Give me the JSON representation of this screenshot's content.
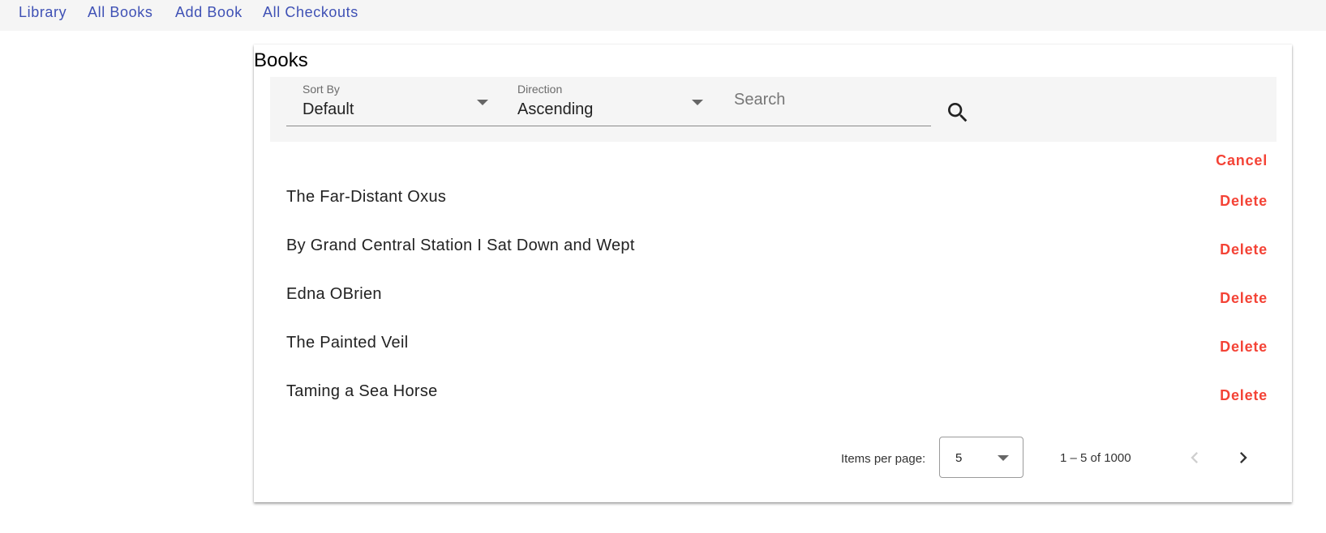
{
  "nav": {
    "items": [
      {
        "label": "Library"
      },
      {
        "label": "All Books"
      },
      {
        "label": "Add Book"
      },
      {
        "label": "All Checkouts"
      }
    ]
  },
  "card": {
    "title": "Books"
  },
  "filters": {
    "sort_by": {
      "label": "Sort By",
      "value": "Default"
    },
    "direction": {
      "label": "Direction",
      "value": "Ascending"
    },
    "search": {
      "placeholder": "Search",
      "value": ""
    },
    "search_icon": "search-icon"
  },
  "cancel_label": "Cancel",
  "books": [
    {
      "title": "The Far-Distant Oxus",
      "delete_label": "Delete"
    },
    {
      "title": "By Grand Central Station I Sat Down and Wept",
      "delete_label": "Delete"
    },
    {
      "title": "Edna OBrien",
      "delete_label": "Delete"
    },
    {
      "title": "The Painted Veil",
      "delete_label": "Delete"
    },
    {
      "title": "Taming a Sea Horse",
      "delete_label": "Delete"
    }
  ],
  "paginator": {
    "items_per_page_label": "Items per page:",
    "items_per_page_value": "5",
    "range_label": "1 – 5 of 1000",
    "prev_icon": "chevron-left-icon",
    "next_icon": "chevron-right-icon"
  },
  "colors": {
    "nav_link": "#3f51b5",
    "warn": "#f44336",
    "panel_bg": "#f5f5f5"
  }
}
